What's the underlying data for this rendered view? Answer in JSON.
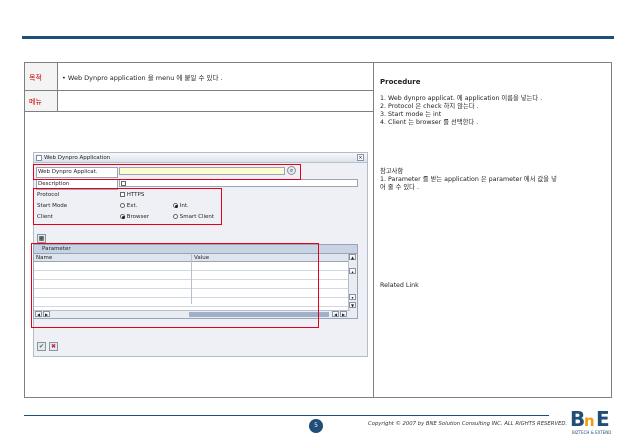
{
  "table": {
    "row1_label": "목적",
    "row1_text": "• Web Dynpro application 을 menu 에 붙일 수 있다 .",
    "row2_label": "메뉴"
  },
  "sap_window": {
    "title": "Web Dynpro Application",
    "fields": {
      "app_label": "Web Dynpro Applicat.",
      "desc_label": "Description",
      "protocol_label": "Protocol",
      "protocol_option": "HTTPS",
      "start_mode_label": "Start Mode",
      "start_ext": "Ext.",
      "start_int": "Int.",
      "client_label": "Client",
      "client_browser": "Browser",
      "client_smart": "Smart Client"
    },
    "parameter_table": {
      "caption": "Parameter",
      "col_name": "Name",
      "col_value": "Value"
    }
  },
  "right": {
    "procedure_title": "Procedure",
    "procedure_lines": [
      "1. Web dynpro applicat. 에 application 이름을 넣는다 .",
      "2. Protocol 은 check 하지 않는다 .",
      "3. Start mode 는 int",
      "4. Client 는 browser 를 선택한다 ."
    ],
    "note_title": "참고사항",
    "note_lines": [
      "1. Parameter 를 받는 application 은 parameter 에서 값을 넣",
      "어 줄 수 있다 ."
    ],
    "related_link": "Related Link"
  },
  "footer": {
    "page": "5",
    "copyright": "Copyright © 2007 by BNE Solution Consulting INC.   ALL RIGHTS RESERVED.",
    "logo_text": "BnE",
    "logo_sub": "BIZTECH & EXTEND"
  },
  "colors": {
    "brand_blue": "#1f4e79",
    "highlight_red": "#e2001a",
    "logo_orange": "#f39c12"
  }
}
